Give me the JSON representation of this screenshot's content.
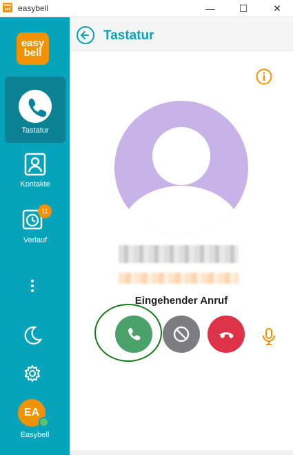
{
  "window": {
    "app_name": "easybell",
    "logo_text": "easy bell"
  },
  "sidebar": {
    "brand_line1": "easy",
    "brand_line2": "bell",
    "items": [
      {
        "label": "Tastatur",
        "icon": "phone-icon",
        "active": true
      },
      {
        "label": "Kontakte",
        "icon": "contact-card-icon",
        "active": false
      },
      {
        "label": "Verlauf",
        "icon": "clock-icon",
        "active": false,
        "badge": "11"
      }
    ],
    "user": {
      "initials": "EA",
      "name": "Easybell",
      "status": "online"
    }
  },
  "header": {
    "title": "Tastatur"
  },
  "call": {
    "caller_number": "",
    "caller_subtitle": "",
    "status": "Eingehender Anruf"
  },
  "colors": {
    "sidebar": "#06a4ba",
    "accent": "#f39200",
    "accept": "#4aa16a",
    "reject": "#7d7d7f",
    "hangup": "#dd3349",
    "avatar_bg": "#c8b3e8"
  }
}
